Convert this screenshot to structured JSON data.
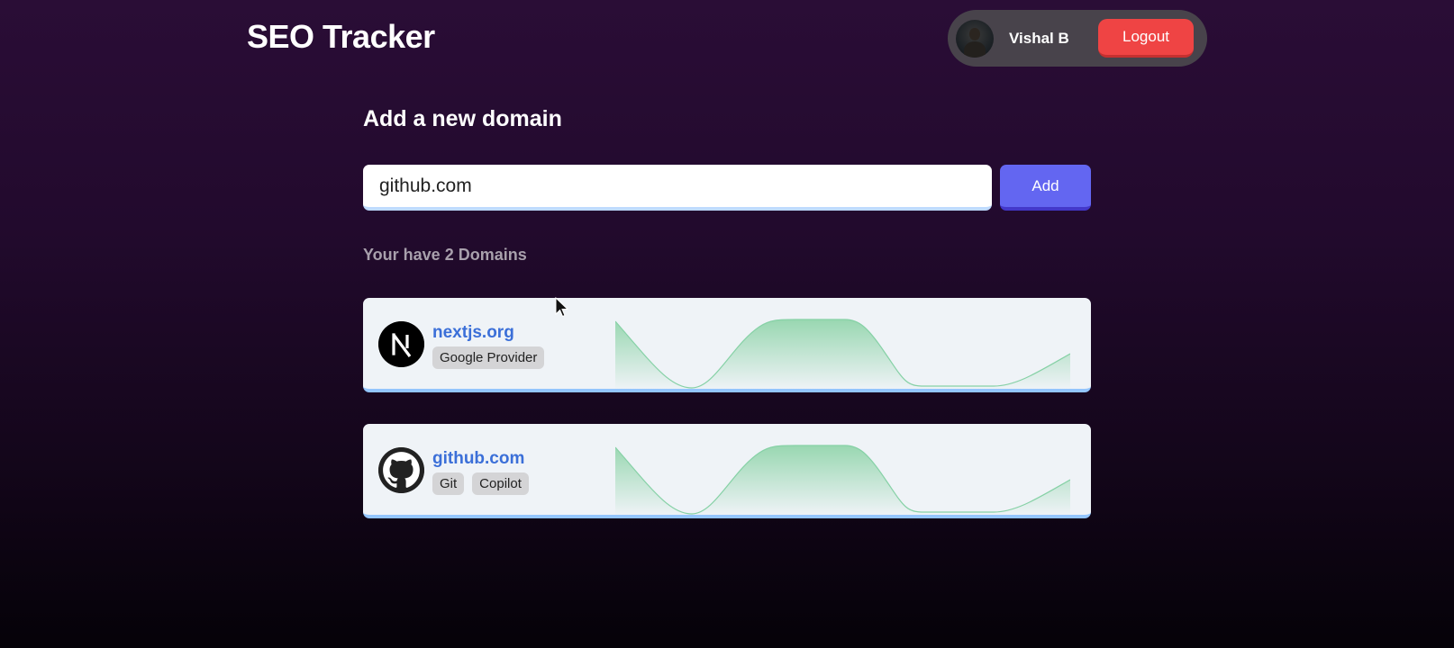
{
  "app": {
    "title": "SEO Tracker"
  },
  "user": {
    "name": "Vishal B",
    "logout_label": "Logout"
  },
  "add_domain": {
    "heading": "Add a new domain",
    "input_value": "github.com",
    "add_label": "Add"
  },
  "domains_count_text": "Your have 2 Domains",
  "domains": [
    {
      "name": "nextjs.org",
      "icon": "nextjs-logo-icon",
      "tags": [
        "Google Provider"
      ]
    },
    {
      "name": "github.com",
      "icon": "github-logo-icon",
      "tags": [
        "Git",
        "Copilot"
      ]
    }
  ],
  "colors": {
    "accent": "#6366f1",
    "logout": "#ef4444",
    "link": "#3b6fd8",
    "chart_line": "#86d1a6"
  }
}
